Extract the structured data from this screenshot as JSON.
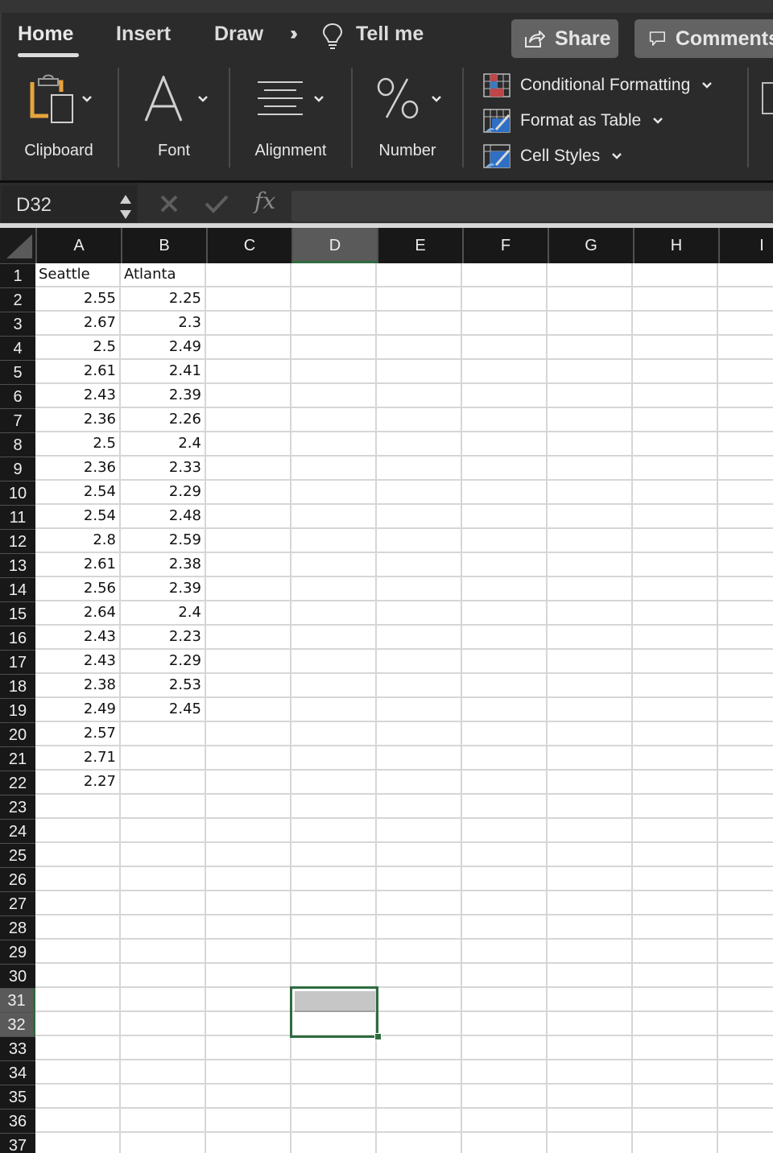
{
  "ribbon": {
    "tabs": [
      {
        "label": "Home",
        "active": true
      },
      {
        "label": "Insert",
        "active": false
      },
      {
        "label": "Draw",
        "active": false
      }
    ],
    "more_icon": "double-chevron-right",
    "tell_me": "Tell me",
    "share_label": "Share",
    "comments_label": "Comments",
    "groups": {
      "clipboard": "Clipboard",
      "font": "Font",
      "alignment": "Alignment",
      "number": "Number"
    },
    "styles": {
      "conditional_formatting": "Conditional Formatting",
      "format_as_table": "Format as Table",
      "cell_styles": "Cell Styles"
    },
    "colors": {
      "ribbon_bg": "#2b2b2b",
      "accent_green": "#2e6b3f",
      "clipboard_orange": "#e8a33d",
      "table_blue": "#2f6fc4",
      "cf_red": "#c0464a"
    }
  },
  "formula_bar": {
    "name_box": "D32",
    "cancel_icon": "x-mark",
    "enter_icon": "check-mark",
    "fx_label": "fx",
    "formula_value": ""
  },
  "sheet": {
    "columns": [
      "A",
      "B",
      "C",
      "D",
      "E",
      "F",
      "G",
      "H",
      "I"
    ],
    "selected_column": "D",
    "selected_rows": [
      31,
      32
    ],
    "active_cell": "D32",
    "row_count_visible": 37,
    "cells": {
      "A": [
        "Seattle",
        "2.55",
        "2.67",
        "2.5",
        "2.61",
        "2.43",
        "2.36",
        "2.5",
        "2.36",
        "2.54",
        "2.54",
        "2.8",
        "2.61",
        "2.56",
        "2.64",
        "2.43",
        "2.43",
        "2.38",
        "2.49",
        "2.57",
        "2.71",
        "2.27"
      ],
      "B": [
        "Atlanta",
        "2.25",
        "2.3",
        "2.49",
        "2.41",
        "2.39",
        "2.26",
        "2.4",
        "2.33",
        "2.29",
        "2.48",
        "2.59",
        "2.38",
        "2.39",
        "2.4",
        "2.23",
        "2.29",
        "2.53",
        "2.45"
      ]
    }
  }
}
